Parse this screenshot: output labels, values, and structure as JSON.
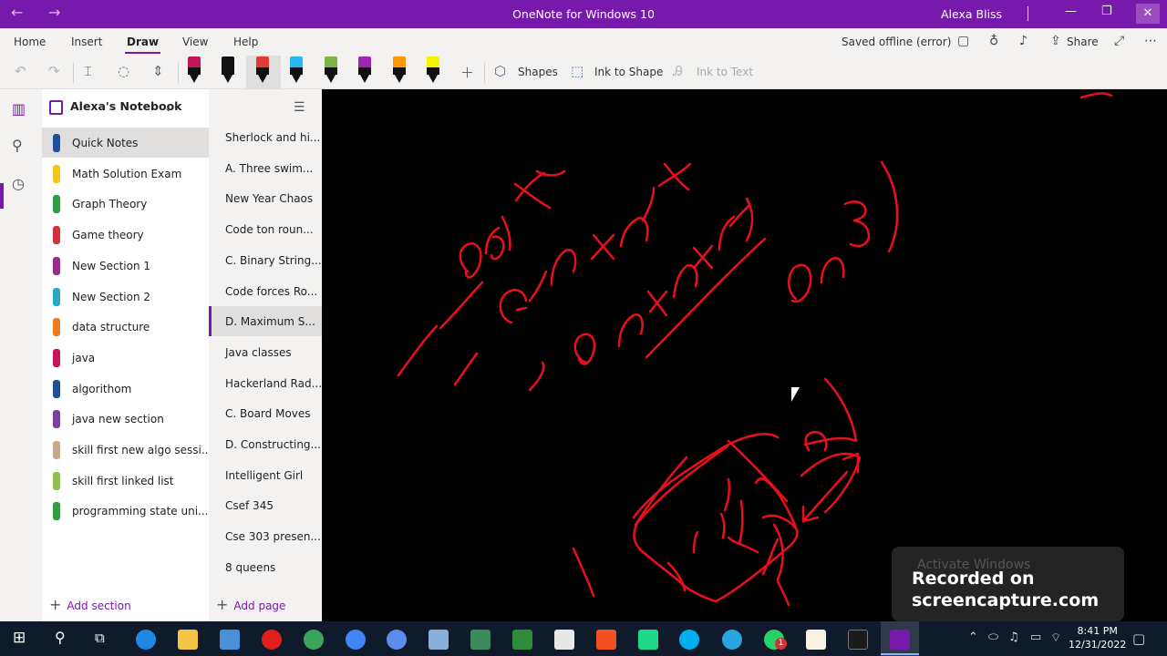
{
  "window": {
    "title": "OneNote for Windows 10",
    "user": "Alexa Bliss"
  },
  "ribbon": {
    "tabs": [
      "Home",
      "Insert",
      "Draw",
      "View",
      "Help"
    ],
    "active_tab": "Draw",
    "status": "Saved offline (error)",
    "share_label": "Share"
  },
  "toolbar": {
    "shapes_label": "Shapes",
    "ink_to_shape_label": "Ink to Shape",
    "ink_to_text_label": "Ink to Text",
    "pens": [
      {
        "cap": "#c2185b"
      },
      {
        "cap": "#111111"
      },
      {
        "cap": "#e53935"
      },
      {
        "cap": "#29b6f6"
      },
      {
        "cap": "#7cb342"
      },
      {
        "cap": "#9c27b0"
      },
      {
        "cap": "#ff9800"
      },
      {
        "cap": "#f4f400"
      }
    ]
  },
  "notebook": {
    "name": "Alexa's Notebook",
    "sections": [
      {
        "label": "Quick Notes",
        "color": "#1f4e9b",
        "selected": true
      },
      {
        "label": "Math Solution Exam",
        "color": "#f5c518"
      },
      {
        "label": "Graph Theory",
        "color": "#2e9e3e"
      },
      {
        "label": "Game theory",
        "color": "#d13438"
      },
      {
        "label": "New Section 1",
        "color": "#9c2a8c"
      },
      {
        "label": "New Section 2",
        "color": "#2aa7c4"
      },
      {
        "label": "data structure",
        "color": "#f07a1e"
      },
      {
        "label": "java",
        "color": "#c2185b"
      },
      {
        "label": "algorithom",
        "color": "#1f4e9b"
      },
      {
        "label": "java new section",
        "color": "#7b3fa6"
      },
      {
        "label": "skill first new algo sessi...",
        "color": "#c8a98a"
      },
      {
        "label": "skill first linked list",
        "color": "#8bc34a"
      },
      {
        "label": "programming state uni...",
        "color": "#2e9e3e"
      }
    ],
    "add_section_label": "Add section"
  },
  "pages": {
    "items": [
      {
        "label": "Sherlock and hi..."
      },
      {
        "label": "A. Three swim..."
      },
      {
        "label": "New Year Chaos"
      },
      {
        "label": "Code ton roun..."
      },
      {
        "label": "C. Binary String..."
      },
      {
        "label": "Code forces Ro..."
      },
      {
        "label": "D. Maximum S...",
        "selected": true
      },
      {
        "label": "Java classes"
      },
      {
        "label": "Hackerland Rad..."
      },
      {
        "label": "C. Board Moves"
      },
      {
        "label": "D. Constructing..."
      },
      {
        "label": "Intelligent Girl"
      },
      {
        "label": "Csef 345"
      },
      {
        "label": "Cse 303 presen..."
      },
      {
        "label": "8 queens"
      }
    ],
    "add_page_label": "Add page"
  },
  "watermark": {
    "activate_text": "Activate Windows",
    "line1": "Recorded on",
    "line2": "screencapture.com"
  },
  "taskbar": {
    "time": "8:41 PM",
    "date": "12/31/2022",
    "notification_badge": "1"
  }
}
